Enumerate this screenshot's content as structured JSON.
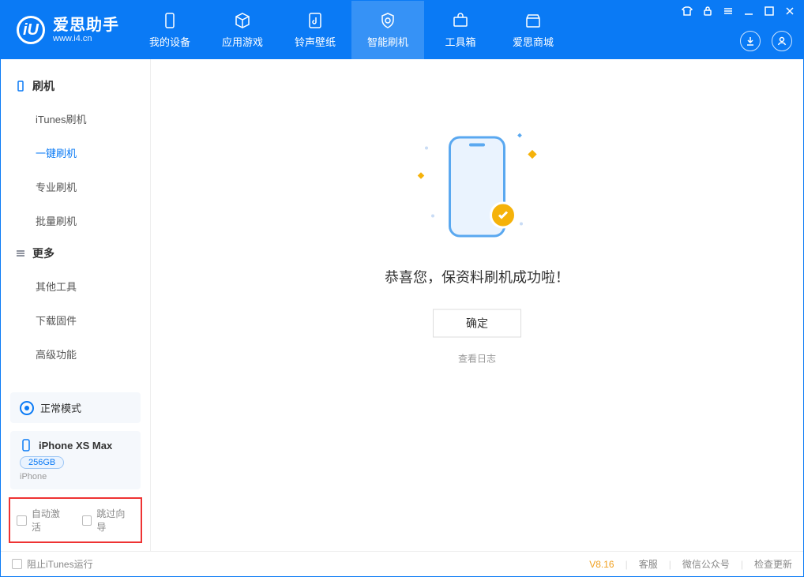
{
  "app": {
    "name": "爱思助手",
    "url": "www.i4.cn"
  },
  "header_tabs": {
    "device": "我的设备",
    "apps": "应用游戏",
    "ring": "铃声壁纸",
    "flash": "智能刷机",
    "tools": "工具箱",
    "shop": "爱思商城"
  },
  "sidebar": {
    "section_flash": "刷机",
    "items_flash": {
      "itunes": "iTunes刷机",
      "oneclick": "一键刷机",
      "pro": "专业刷机",
      "batch": "批量刷机"
    },
    "section_more": "更多",
    "items_more": {
      "other": "其他工具",
      "firmware": "下载固件",
      "advanced": "高级功能"
    },
    "mode": "正常模式",
    "device_name": "iPhone XS Max",
    "device_capacity": "256GB",
    "device_type": "iPhone",
    "chk_auto_activate": "自动激活",
    "chk_skip_guide": "跳过向导"
  },
  "main": {
    "success_msg": "恭喜您，保资料刷机成功啦！",
    "ok_btn": "确定",
    "view_log": "查看日志"
  },
  "footer": {
    "block_itunes": "阻止iTunes运行",
    "version": "V8.16",
    "support": "客服",
    "wechat": "微信公众号",
    "update": "检查更新"
  }
}
